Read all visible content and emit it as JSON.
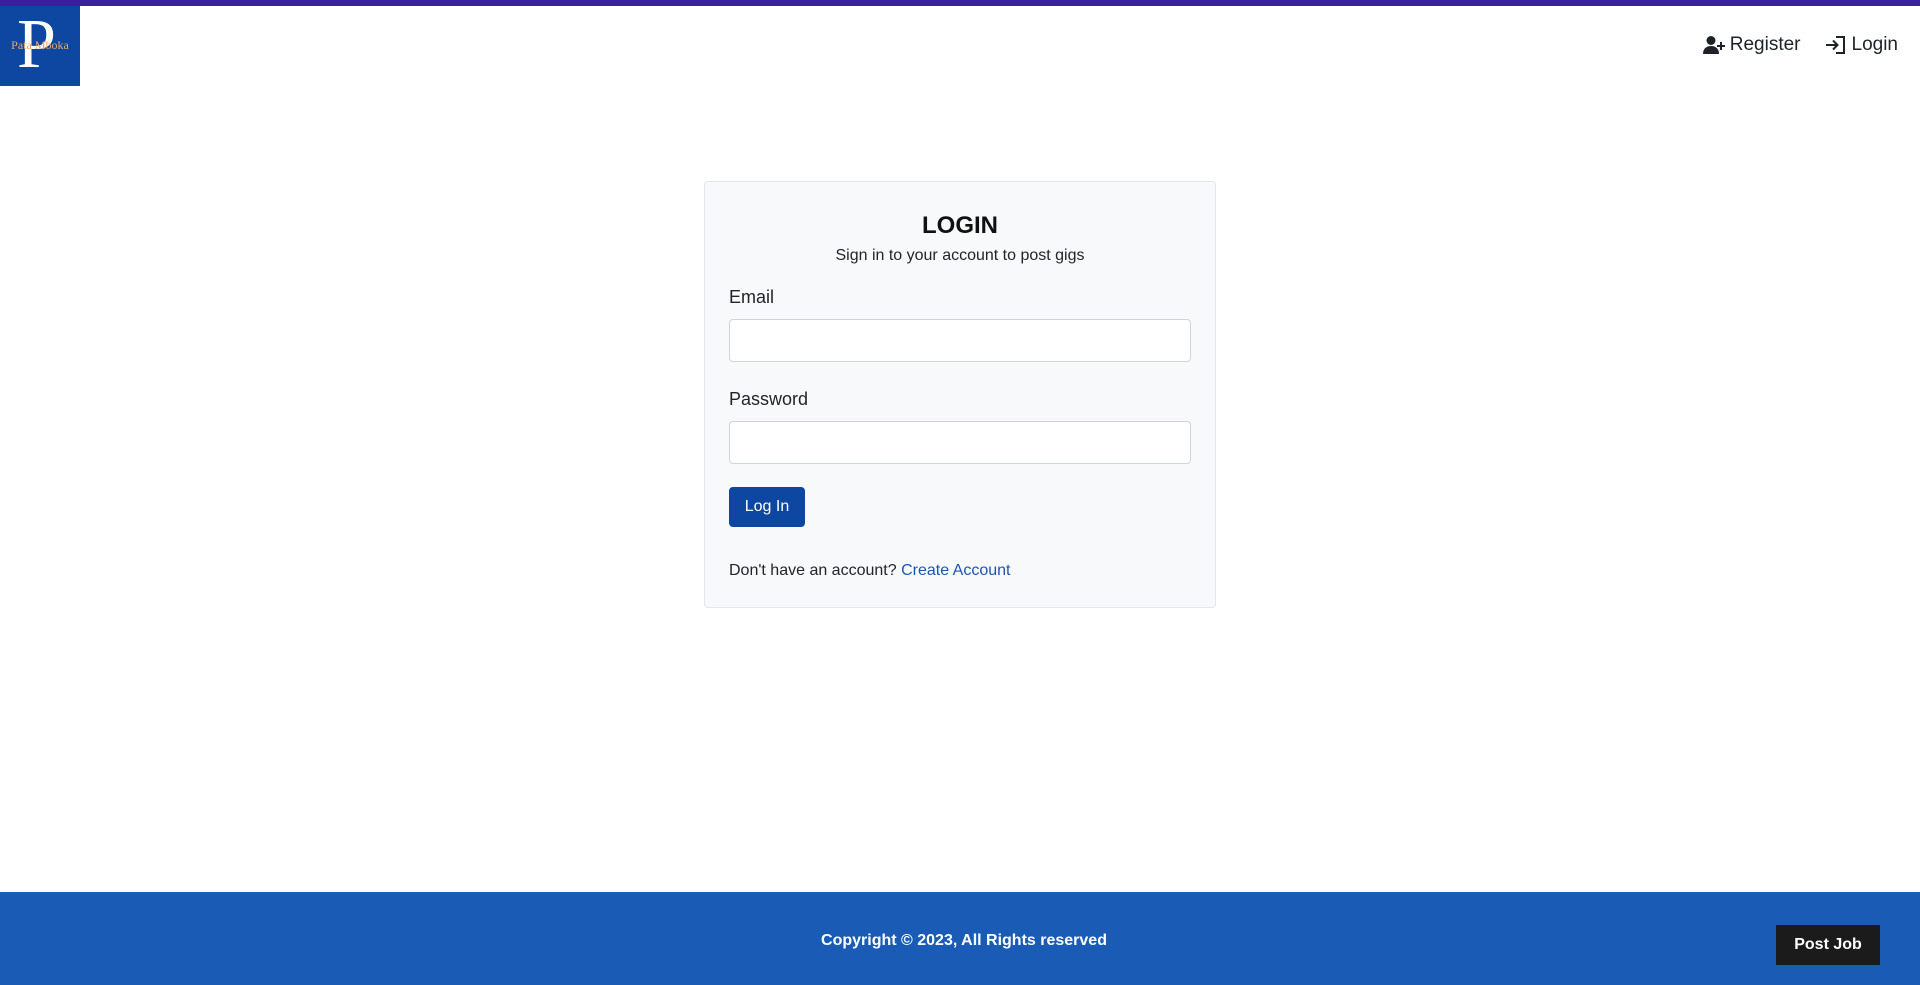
{
  "brand": {
    "logo_text": "Pata Mboka",
    "logo_letter": "P"
  },
  "nav": {
    "register_label": "Register",
    "login_label": "Login"
  },
  "login_card": {
    "title": "LOGIN",
    "subtitle": "Sign in to your account to post gigs",
    "email_label": "Email",
    "email_value": "",
    "password_label": "Password",
    "password_value": "",
    "submit_label": "Log In",
    "no_account_text": "Don't have an account?",
    "create_account_link": "Create Account"
  },
  "footer": {
    "copyright": "Copyright © 2023, All Rights reserved",
    "post_job_label": "Post Job"
  },
  "colors": {
    "top_bar": "#3a1f9e",
    "primary": "#0d47a1",
    "footer_bg": "#1a5cb5",
    "link": "#1a56b0"
  },
  "icons": {
    "register": "user-plus-icon",
    "login": "sign-in-icon"
  }
}
